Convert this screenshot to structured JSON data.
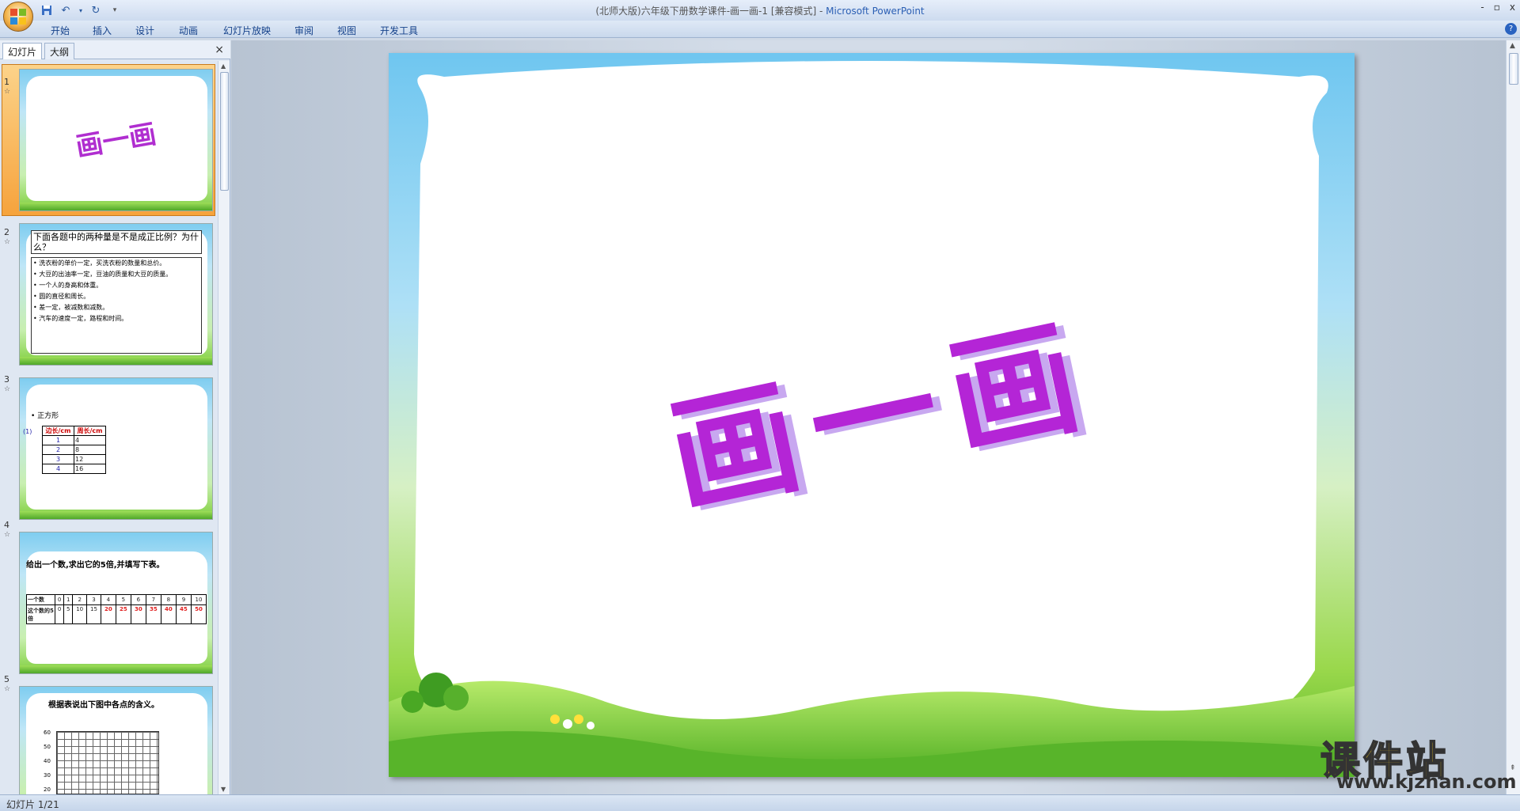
{
  "window": {
    "title_doc": "(北师大版)六年级下册数学课件-画一画-1 [兼容模式] - ",
    "title_app": "Microsoft PowerPoint",
    "controls": [
      "-",
      "▫",
      "x"
    ]
  },
  "ribbon": {
    "tabs": [
      "开始",
      "插入",
      "设计",
      "动画",
      "幻灯片放映",
      "审阅",
      "视图",
      "开发工具"
    ],
    "help": "?"
  },
  "left_panel": {
    "tabs": [
      "幻灯片",
      "大纲"
    ],
    "close": "×"
  },
  "slides": [
    {
      "num": "1",
      "title": "画一画"
    },
    {
      "num": "2",
      "title": "下面各题中的两种量是不是成正比例？为什么？",
      "bullets": [
        "洗衣粉的单价一定，买洗衣粉的数量和总价。",
        "大豆的出油率一定，豆油的质量和大豆的质量。",
        "一个人的身高和体重。",
        "圆的直径和周长。",
        "差一定，被减数和减数。",
        "汽车的速度一定，路程和时间。"
      ]
    },
    {
      "num": "3",
      "bullet": "正方形",
      "side_label": "(1)",
      "table_header": [
        "边长/cm",
        "周长/cm"
      ],
      "rows": [
        [
          "1",
          "4"
        ],
        [
          "2",
          "8"
        ],
        [
          "3",
          "12"
        ],
        [
          "4",
          "16"
        ]
      ]
    },
    {
      "num": "4",
      "title": "给出一个数,求出它的5倍,并填写下表。",
      "row1_label": "一个数",
      "row1": [
        "0",
        "1",
        "2",
        "3",
        "4",
        "5",
        "6",
        "7",
        "8",
        "9",
        "10"
      ],
      "row2_label": "这个数的5倍",
      "row2": [
        "0",
        "5",
        "10",
        "15",
        "20",
        "25",
        "30",
        "35",
        "40",
        "45",
        "50"
      ]
    },
    {
      "num": "5",
      "title": "根据表说出下图中各点的含义。",
      "y_ticks": [
        "60",
        "50",
        "40",
        "30",
        "20"
      ]
    }
  ],
  "main_slide": {
    "title": "画一画"
  },
  "status": {
    "text": "幻灯片 1/21"
  },
  "watermark": {
    "big": "课件站",
    "url": "www.kjzhan.com"
  }
}
